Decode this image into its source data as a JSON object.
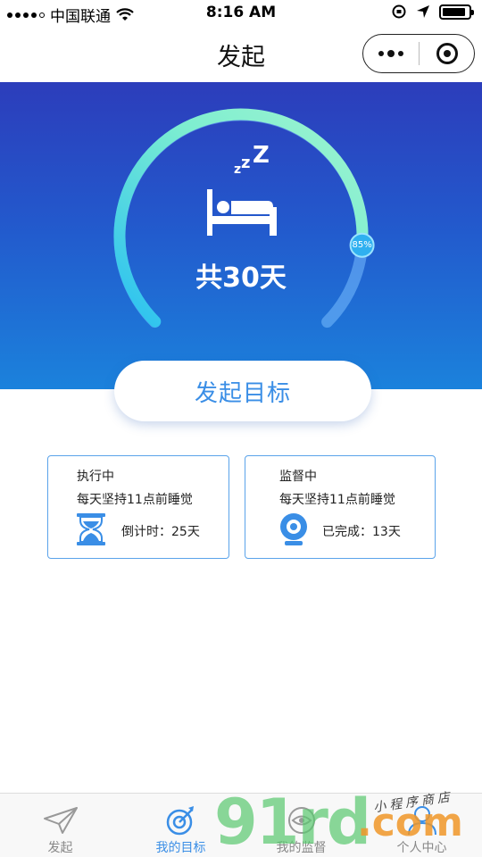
{
  "status_bar": {
    "carrier": "中国联通",
    "time": "8:16 AM"
  },
  "navbar": {
    "title": "发起",
    "more_icon": "more-dots-icon",
    "close_icon": "target-circle-icon"
  },
  "hero": {
    "progress_percent": 85,
    "progress_label": "85%",
    "total_days_label": "共30天",
    "icon": "sleeping-bed-icon",
    "colors": {
      "gradient_top": "#2c3dbb",
      "gradient_bottom": "#1b82dc",
      "arc_start": "#29c7f0",
      "arc_end": "#8af0c8"
    }
  },
  "start_button": {
    "label": "发起目标"
  },
  "cards": [
    {
      "status": "执行中",
      "goal": "每天坚持11点前睡觉",
      "meta": "倒计时：25天",
      "icon": "hourglass-icon"
    },
    {
      "status": "监督中",
      "goal": "每天坚持11点前睡觉",
      "meta": "已完成：13天",
      "icon": "webcam-icon"
    }
  ],
  "tabbar": {
    "tabs": [
      {
        "label": "发起",
        "icon": "paper-plane-icon",
        "active": false
      },
      {
        "label": "我的目标",
        "icon": "target-arrow-icon",
        "active": true
      },
      {
        "label": "我的监督",
        "icon": "eye-icon",
        "active": false
      },
      {
        "label": "个人中心",
        "icon": "user-icon",
        "active": false
      }
    ]
  },
  "watermark": {
    "big": "91rd",
    "dot": ".com",
    "small": "小程序商店"
  }
}
